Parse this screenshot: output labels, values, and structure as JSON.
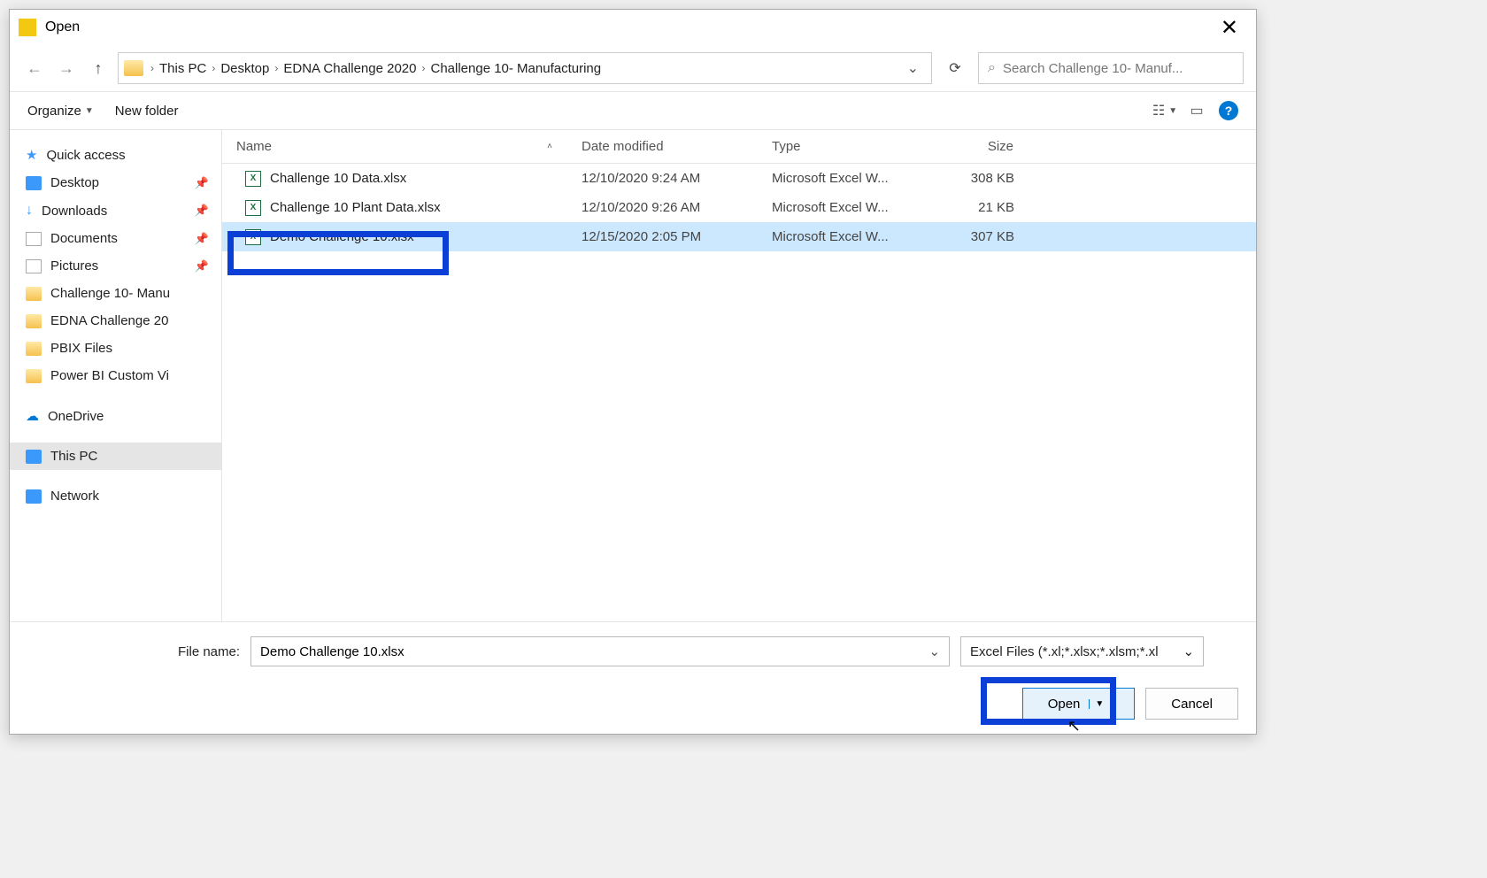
{
  "title": "Open",
  "breadcrumb": {
    "segments": [
      "This PC",
      "Desktop",
      "EDNA Challenge 2020",
      "Challenge 10- Manufacturing"
    ]
  },
  "search": {
    "placeholder": "Search Challenge 10- Manuf..."
  },
  "toolbar": {
    "organize": "Organize",
    "new_folder": "New folder"
  },
  "sidebar": {
    "quick_access": "Quick access",
    "items_pinned": [
      {
        "label": "Desktop"
      },
      {
        "label": "Downloads"
      },
      {
        "label": "Documents"
      },
      {
        "label": "Pictures"
      }
    ],
    "items_folders": [
      {
        "label": "Challenge 10- Manu"
      },
      {
        "label": "EDNA Challenge 20"
      },
      {
        "label": "PBIX Files"
      },
      {
        "label": "Power BI Custom Vi"
      }
    ],
    "onedrive": "OneDrive",
    "this_pc": "This PC",
    "network": "Network"
  },
  "columns": {
    "name": "Name",
    "date": "Date modified",
    "type": "Type",
    "size": "Size"
  },
  "files": [
    {
      "name": "Challenge 10 Data.xlsx",
      "date": "12/10/2020 9:24 AM",
      "type": "Microsoft Excel W...",
      "size": "308 KB",
      "selected": false
    },
    {
      "name": "Challenge 10 Plant Data.xlsx",
      "date": "12/10/2020 9:26 AM",
      "type": "Microsoft Excel W...",
      "size": "21 KB",
      "selected": false
    },
    {
      "name": "Demo Challenge 10.xlsx",
      "date": "12/15/2020 2:05 PM",
      "type": "Microsoft Excel W...",
      "size": "307 KB",
      "selected": true
    }
  ],
  "filename": {
    "label": "File name:",
    "value": "Demo Challenge 10.xlsx"
  },
  "filter": "Excel Files (*.xl;*.xlsx;*.xlsm;*.xl",
  "buttons": {
    "open": "Open",
    "cancel": "Cancel"
  }
}
